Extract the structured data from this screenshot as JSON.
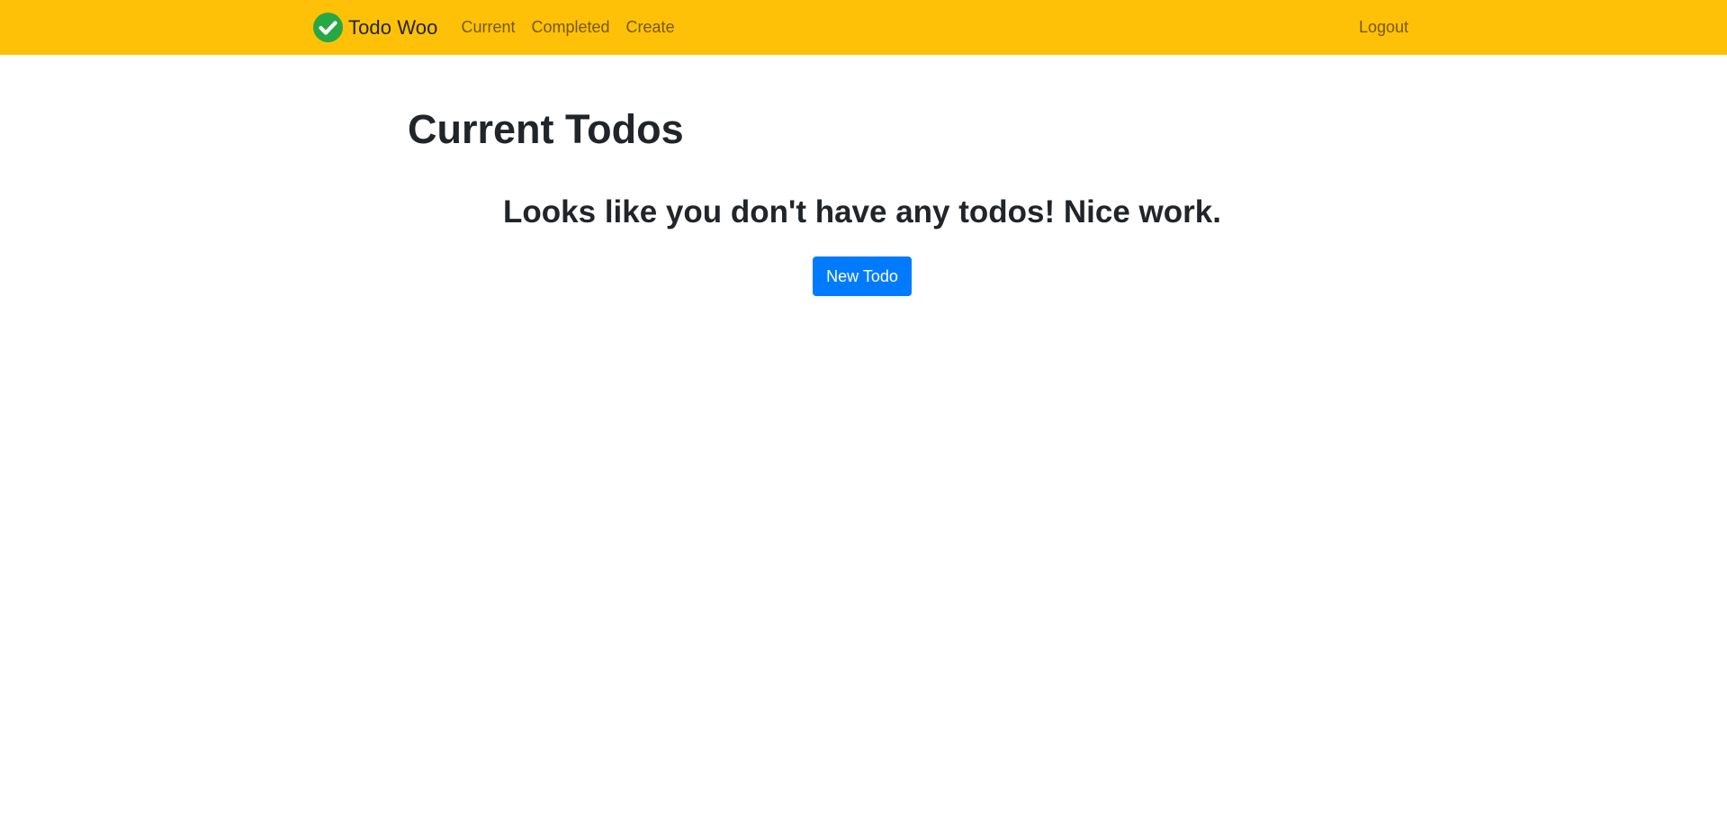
{
  "navbar": {
    "brand": {
      "logo_icon": "check-circle-icon",
      "name": "Todo Woo"
    },
    "links": [
      {
        "label": "Current"
      },
      {
        "label": "Completed"
      },
      {
        "label": "Create"
      }
    ],
    "logout_label": "Logout"
  },
  "main": {
    "title": "Current Todos",
    "empty_message": "Looks like you don't have any todos! Nice work.",
    "new_todo_label": "New Todo"
  },
  "colors": {
    "navbar_bg": "#ffc107",
    "logo_green": "#28a745",
    "primary_button": "#007bff",
    "text": "#212529"
  }
}
